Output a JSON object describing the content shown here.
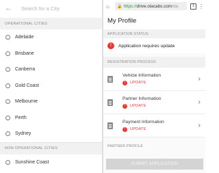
{
  "search": {
    "placeholder": "Search for a City",
    "back_icon": "arrow-left-icon"
  },
  "operational": {
    "heading": "OPERATIONAL CITIES",
    "cities": [
      {
        "name": "Adelaide"
      },
      {
        "name": "Brisbane"
      },
      {
        "name": "Canberra"
      },
      {
        "name": "Gold Coast"
      },
      {
        "name": "Melbourne"
      },
      {
        "name": "Perth"
      },
      {
        "name": "Sydney"
      }
    ]
  },
  "non_operational": {
    "heading": "NON OPERATIONAL CITIES",
    "cities": [
      {
        "name": "Sunshine Coast"
      }
    ]
  },
  "browser": {
    "url_protocol": "https://",
    "url_host": "drive.olacabs.com",
    "url_path": "/da",
    "tab_count": "1",
    "home_icon": "home-icon",
    "lock_icon": "lock-icon",
    "menu_icon": "kebab-menu-icon"
  },
  "profile": {
    "title": "My Profile",
    "status_heading": "APPLICATION STATUS",
    "status_text": "Application requires update",
    "status_icon": "alert-circle-icon",
    "process_heading": "REGISTRATION PROCESS",
    "steps": [
      {
        "title": "Vehicle Information",
        "status": "UPDATE"
      },
      {
        "title": "Partner Information",
        "status": "UPDATE"
      },
      {
        "title": "Payment Information",
        "status": "UPDATE"
      }
    ],
    "partner_heading": "PARTNER PROFILE",
    "submit_label": "SUBMIT APPLICATION"
  },
  "colors": {
    "alert": "#e53935",
    "secure": "#2a9a4a",
    "disabled_button": "#d4d4d4"
  }
}
